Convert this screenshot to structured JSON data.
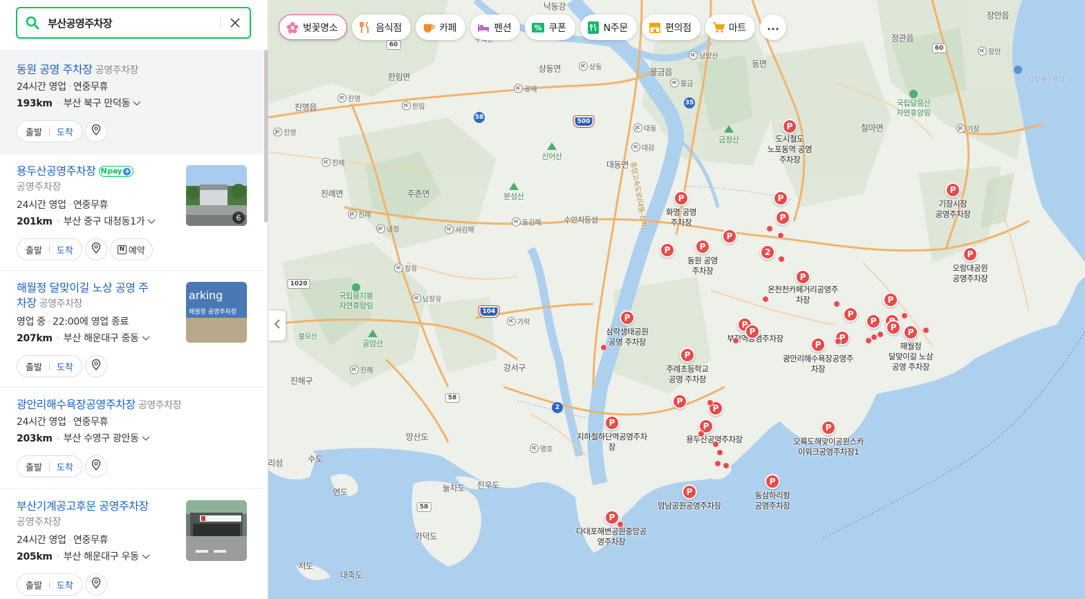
{
  "search": {
    "query": "부산공영주차장"
  },
  "results": [
    {
      "name": "동원 공영 주차장",
      "category": "공영주차장",
      "hours_status": "24시간 영업",
      "hours_detail": "연중무휴",
      "distance": "193km",
      "address": "부산 북구 만덕동",
      "depart_label": "출발",
      "arrive_label": "도착"
    },
    {
      "name": "용두산공영주차장",
      "category": "공영주차장",
      "npay": "pay",
      "hours_status": "24시간 영업",
      "hours_detail": "연중무휴",
      "distance": "201km",
      "address": "부산 중구 대청동1가",
      "depart_label": "출발",
      "arrive_label": "도착",
      "reserve_label": "예약",
      "photo_count": "6"
    },
    {
      "name": "해월정 달맞이길 노상 공영 주차장",
      "name_line1": "해월정 달맞이길 노상 공영 주",
      "name_line2": "차장",
      "category": "공영주차장",
      "hours_status": "영업 중",
      "hours_detail": "22:00에 영업 종료",
      "distance": "207km",
      "address": "부산 해운대구 중동",
      "depart_label": "출발",
      "arrive_label": "도착",
      "thumb_text_1": "arking",
      "thumb_text_2": "해월정 공영주차장"
    },
    {
      "name": "광안리해수욕장공영주차장",
      "category": "공영주차장",
      "hours_status": "24시간 영업",
      "hours_detail": "연중무휴",
      "distance": "203km",
      "address": "부산 수영구 광안동",
      "depart_label": "출발",
      "arrive_label": "도착"
    },
    {
      "name": "부산기계공고후문 공영주차장",
      "category": "공영주차장",
      "hours_status": "24시간 영업",
      "hours_detail": "연중무휴",
      "distance": "205km",
      "address": "부산 해운대구 우동",
      "depart_label": "출발",
      "arrive_label": "도착"
    }
  ],
  "chips": [
    {
      "label": "벚꽃명소",
      "icon": "cherry-blossom-icon",
      "active": true
    },
    {
      "label": "음식점",
      "icon": "fork-knife-icon"
    },
    {
      "label": "카페",
      "icon": "cup-icon"
    },
    {
      "label": "펜션",
      "icon": "bed-icon"
    },
    {
      "label": "쿠폰",
      "icon": "coupon-icon"
    },
    {
      "label": "N주문",
      "icon": "order-icon"
    },
    {
      "label": "편의점",
      "icon": "store-icon"
    },
    {
      "label": "마트",
      "icon": "cart-icon"
    }
  ],
  "map": {
    "places": [
      {
        "t": "낙동강"
      },
      {
        "t": "우직산"
      },
      {
        "t": "상동면"
      },
      {
        "t": "한림면"
      },
      {
        "t": "진영읍"
      },
      {
        "t": "물금읍"
      },
      {
        "t": "동면"
      },
      {
        "t": "정관읍"
      },
      {
        "t": "장안읍"
      },
      {
        "t": "철마면"
      },
      {
        "t": "대동면"
      },
      {
        "t": "주촌면"
      },
      {
        "t": "진례면"
      },
      {
        "t": "불모산"
      },
      {
        "t": "강서구"
      },
      {
        "t": "진해구"
      },
      {
        "t": "망산도"
      },
      {
        "t": "수도"
      },
      {
        "t": "연도"
      },
      {
        "t": "눌차도"
      },
      {
        "t": "진우도"
      },
      {
        "t": "가덕도"
      },
      {
        "t": "저도"
      },
      {
        "t": "대죽도"
      },
      {
        "t": "리섬"
      },
      {
        "t": "수안치등섬"
      },
      {
        "t": "임랑해수욕장"
      }
    ],
    "green_labels": [
      {
        "t": "신어산"
      },
      {
        "t": "분성산"
      },
      {
        "t": "금정산"
      },
      {
        "t": "굴암산"
      },
      {
        "t": "국립용지봉 자연휴양림",
        "l1": "국립용지봉",
        "l2": "자연휴양림"
      },
      {
        "t": "국립달음산 자연휴양림",
        "l1": "국립달음산",
        "l2": "자연휴양림"
      }
    ],
    "ic": [
      {
        "t": "진영"
      },
      {
        "t": "한림"
      },
      {
        "t": "진영"
      },
      {
        "t": "광재"
      },
      {
        "t": "상동"
      },
      {
        "t": "남양산"
      },
      {
        "t": "물금"
      },
      {
        "t": "대동"
      },
      {
        "t": "대감"
      },
      {
        "t": "진례"
      },
      {
        "t": "진례"
      },
      {
        "t": "냉정"
      },
      {
        "t": "서김해"
      },
      {
        "t": "동김해"
      },
      {
        "t": "장유"
      },
      {
        "t": "남장유"
      },
      {
        "t": "가락"
      },
      {
        "t": "진해"
      },
      {
        "t": "명호"
      },
      {
        "t": "기장"
      },
      {
        "t": "장안"
      }
    ],
    "highways": [
      {
        "t": "60"
      },
      {
        "t": "58"
      },
      {
        "t": "500"
      },
      {
        "t": "35"
      },
      {
        "t": "1020"
      },
      {
        "t": "104"
      },
      {
        "t": "58"
      },
      {
        "t": "2"
      },
      {
        "t": "58"
      },
      {
        "t": "60"
      }
    ],
    "road_label": "중앙고속도로(대동-삼락)",
    "pins": [
      {
        "label": "도시철도 노포동역 공영 주차장",
        "l1": "도시철도",
        "l2": "노포동역 공영",
        "l3": "주차장"
      },
      {
        "label": "화명 공영 주차장",
        "l1": "화명 공영",
        "l2": "주차장"
      },
      {
        "label": "동원 공영 주차장",
        "l1": "동원 공영",
        "l2": "주차장"
      },
      {
        "label": "기장시장 공영주차장",
        "l1": "기장시장",
        "l2": "공영주차장"
      },
      {
        "label": "오랑대공원 공영주차장",
        "l1": "오랑대공원",
        "l2": "공영주차장"
      },
      {
        "label": "온천천카페거리공영주차장",
        "l1": "온천천카페거리공영주",
        "l2": "차장"
      },
      {
        "label": "삼락생태공원 공영 주차장",
        "l1": "삼락생태공원",
        "l2": "공영 주차장"
      },
      {
        "label": "부전역공영주차장",
        "l1": "부전역공영주차장"
      },
      {
        "label": "광안리해수욕장공영주차장",
        "l1": "광안리해수욕장공영주",
        "l2": "차장"
      },
      {
        "label": "해월정 달맞이길 노상 공영 주차장",
        "l1": "해월정",
        "l2": "달맞이길 노상",
        "l3": "공영 주차장"
      },
      {
        "label": "주례초등학교 공영 주차장",
        "l1": "주례초등학교",
        "l2": "공영 주차장"
      },
      {
        "label": "지하철하단역공영주차장",
        "l1": "지하철하단역공영주차",
        "l2": "장"
      },
      {
        "label": "용두산공영주차장",
        "l1": "용두산공영주차장"
      },
      {
        "label": "오륙도해맞이공원스카이워크공영주차장1",
        "l1": "오륙도해맞이공원스카",
        "l2": "이워크공영주차장1"
      },
      {
        "label": "동삼하리항 공영주차장",
        "l1": "동삼하리항",
        "l2": "공영주차장"
      },
      {
        "label": "암남공원공영주차장",
        "l1": "암남공원공영주차장"
      },
      {
        "label": "다대포해변공원중앙공영주차장",
        "l1": "다대포해변공원중앙공",
        "l2": "영주차장"
      }
    ],
    "cluster_badges": [
      {
        "t": "2"
      }
    ],
    "pin_glyph": "P"
  }
}
